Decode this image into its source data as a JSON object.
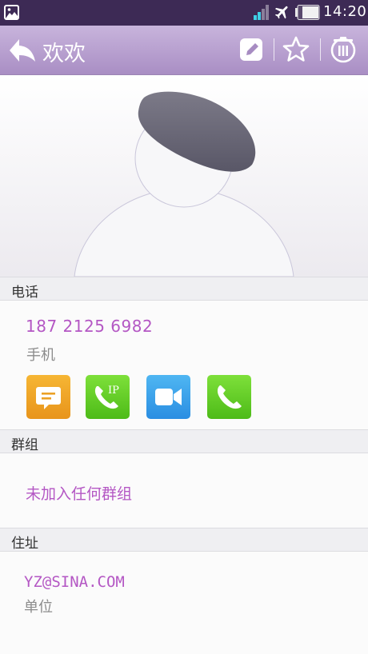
{
  "status_bar": {
    "time": "14:20",
    "icons": [
      "gallery-icon",
      "signal-icon",
      "airplane-mode-icon",
      "battery-icon"
    ]
  },
  "header": {
    "title": "欢欢",
    "actions": [
      "back-arrow-icon",
      "edit-icon",
      "star-icon",
      "delete-icon"
    ]
  },
  "contact_photo": {
    "icon": "default-avatar-icon"
  },
  "sections": {
    "phone": {
      "title": "电话",
      "number": "187 2125 6982",
      "type_label": "手机",
      "actions": [
        "message-icon",
        "ip-call-icon",
        "video-call-icon",
        "phone-call-icon"
      ]
    },
    "groups": {
      "title": "群组",
      "value": "未加入任何群组"
    },
    "address": {
      "title": "住址",
      "value": "YZ@SINA.COM",
      "type_label": "单位"
    }
  },
  "colors": {
    "accent": "#b457c4",
    "appbar_top": "#c8b4dc",
    "appbar_bottom": "#a98ec4",
    "status_bar": "#3d2a55"
  }
}
